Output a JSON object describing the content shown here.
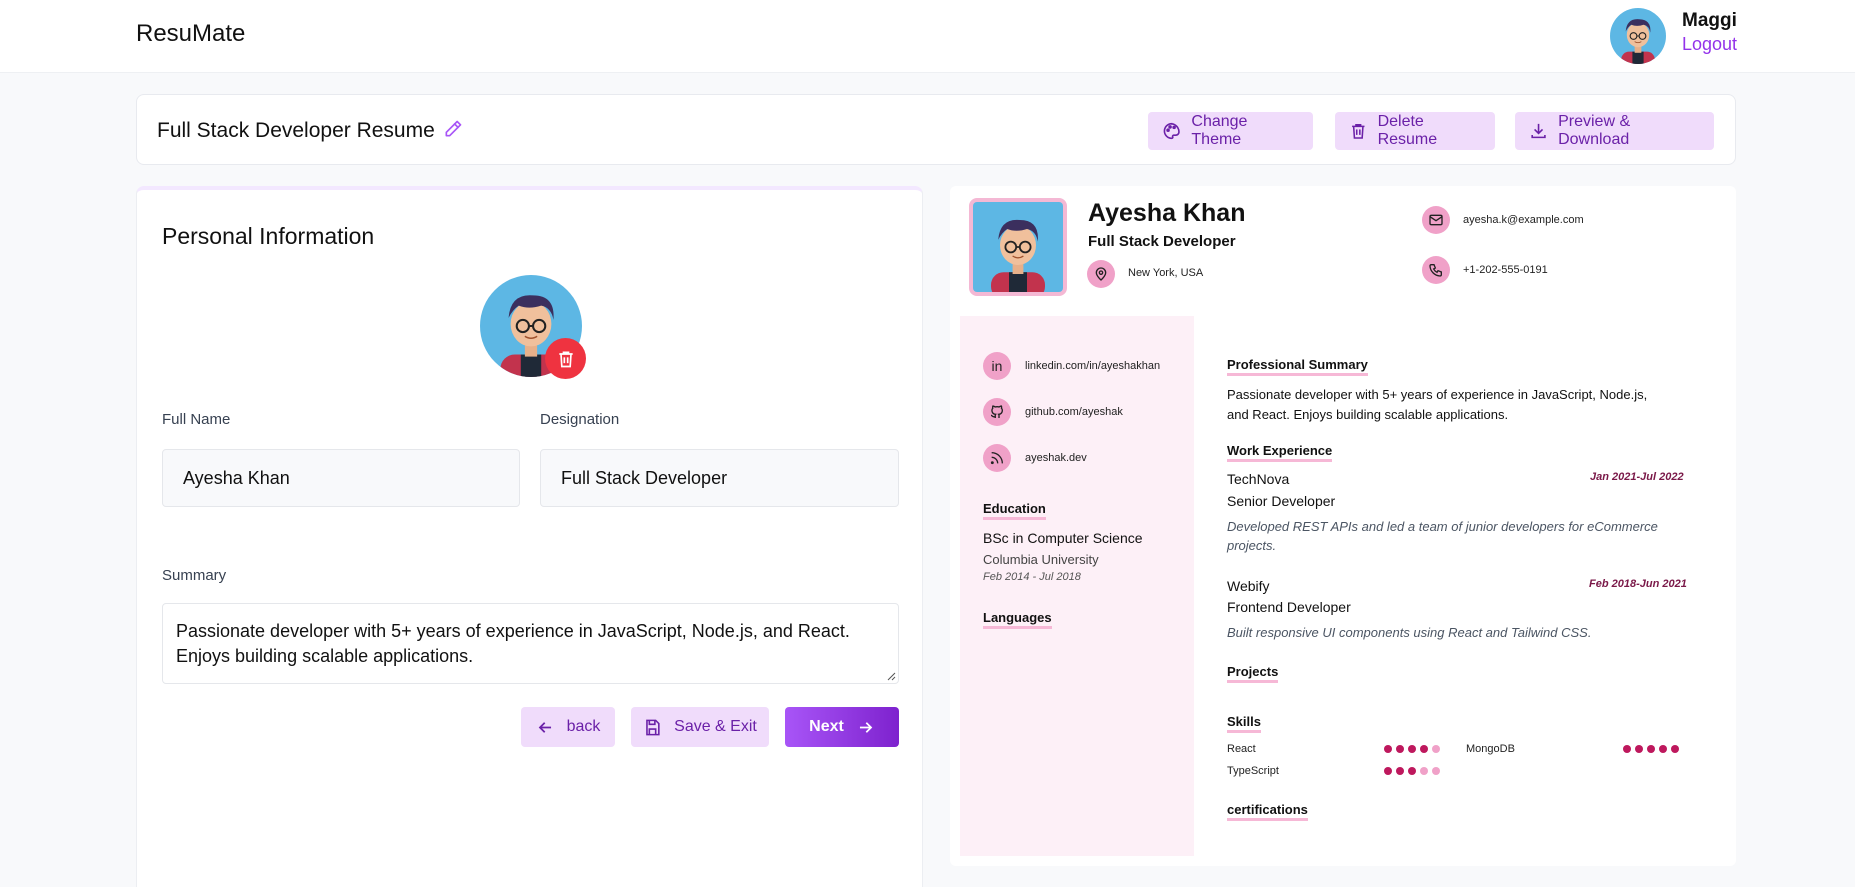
{
  "app": {
    "brand": "ResuMate"
  },
  "user": {
    "name": "Maggi",
    "logout_label": "Logout"
  },
  "titlebar": {
    "title": "Full Stack Developer Resume",
    "change_theme": "Change Theme",
    "delete_resume": "Delete Resume",
    "preview_download": "Preview & Download"
  },
  "form": {
    "section_title": "Personal Information",
    "full_name_label": "Full Name",
    "full_name_value": "Ayesha Khan",
    "designation_label": "Designation",
    "designation_value": "Full Stack Developer",
    "summary_label": "Summary",
    "summary_value": "Passionate developer with 5+ years of experience in JavaScript, Node.js, and React. Enjoys building scalable applications.",
    "back_label": "back",
    "save_exit_label": "Save & Exit",
    "next_label": "Next"
  },
  "preview": {
    "name": "Ayesha Khan",
    "role": "Full Stack Developer",
    "location": "New York, USA",
    "email": "ayesha.k@example.com",
    "phone": "+1-202-555-0191",
    "links": {
      "linkedin": "linkedin.com/in/ayeshakhan",
      "github": "github.com/ayeshak",
      "website": "ayeshak.dev"
    },
    "education_heading": "Education",
    "education": {
      "degree": "BSc in Computer Science",
      "school": "Columbia University",
      "dates": "Feb 2014 - Jul 2018"
    },
    "languages_heading": "Languages",
    "summary_heading": "Professional Summary",
    "summary_line1": "Passionate developer with 5+ years of experience in JavaScript, Node.js,",
    "summary_line2": "and React. Enjoys building scalable applications.",
    "work_heading": "Work Experience",
    "work": [
      {
        "company": "TechNova",
        "title": "Senior Developer",
        "dates": "Jan 2021-Jul 2022",
        "desc1": "Developed REST APIs and led a team of junior developers for eCommerce",
        "desc2": "projects."
      },
      {
        "company": "Webify",
        "title": "Frontend Developer",
        "dates": "Feb 2018-Jun 2021",
        "desc1": "Built responsive UI components using React and Tailwind CSS."
      }
    ],
    "projects_heading": "Projects",
    "skills_heading": "Skills",
    "skills": [
      {
        "name": "React",
        "level": 4
      },
      {
        "name": "MongoDB",
        "level": 5
      },
      {
        "name": "TypeScript",
        "level": 3
      }
    ],
    "certifications_heading": "certifications"
  },
  "colors": {
    "accent": "#9333ea",
    "soft_button": "#f0dcfb",
    "preview_accent": "#f0a1c8",
    "skill_dot": "#be185d",
    "delete_red": "#ef3340"
  }
}
